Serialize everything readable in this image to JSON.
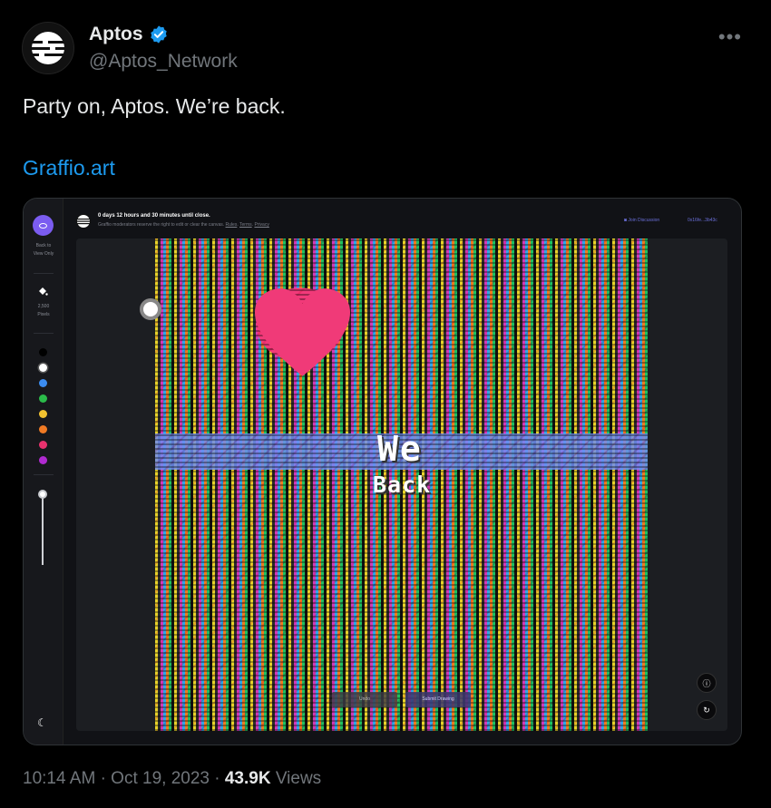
{
  "author": {
    "name": "Aptos",
    "handle": "@Aptos_Network",
    "avatar_icon": "aptos-logo-icon",
    "verified_icon": "verified-badge-icon",
    "verified_color": "#1d9bf0"
  },
  "tweet": {
    "text": "Party on, Aptos. We’re back.",
    "link": "Graffio.art",
    "more_label": "•••"
  },
  "media": {
    "topbar": {
      "title": "0 days 12 hours and 30 minutes until close.",
      "subtitle": "Graffio moderators reserve the right to edit or clear the canvas.",
      "rules": "Rules",
      "terms": "Terms",
      "privacy": "Privacy",
      "join": "Join Discussion",
      "wallet": "0x16fe...3b43c"
    },
    "rail": {
      "back_line1": "Back to",
      "back_line2": "View Only",
      "pixels_count": "2,500",
      "pixels_label": "Pixels",
      "swatches": [
        "#000000",
        "#ffffff",
        "#3b8cf0",
        "#2bbb4a",
        "#f2c230",
        "#f07a24",
        "#e8326e",
        "#b02ad0"
      ],
      "brush_level": 0.0
    },
    "canvas": {
      "text_line1": "We",
      "text_line2": "Back",
      "undo_label": "Undo",
      "submit_label": "Submit Drawing",
      "accent": "#7b5cf0"
    }
  },
  "footer": {
    "time": "10:14 AM",
    "separator": "·",
    "date": "Oct 19, 2023",
    "views_count": "43.9K",
    "views_label": "Views"
  }
}
